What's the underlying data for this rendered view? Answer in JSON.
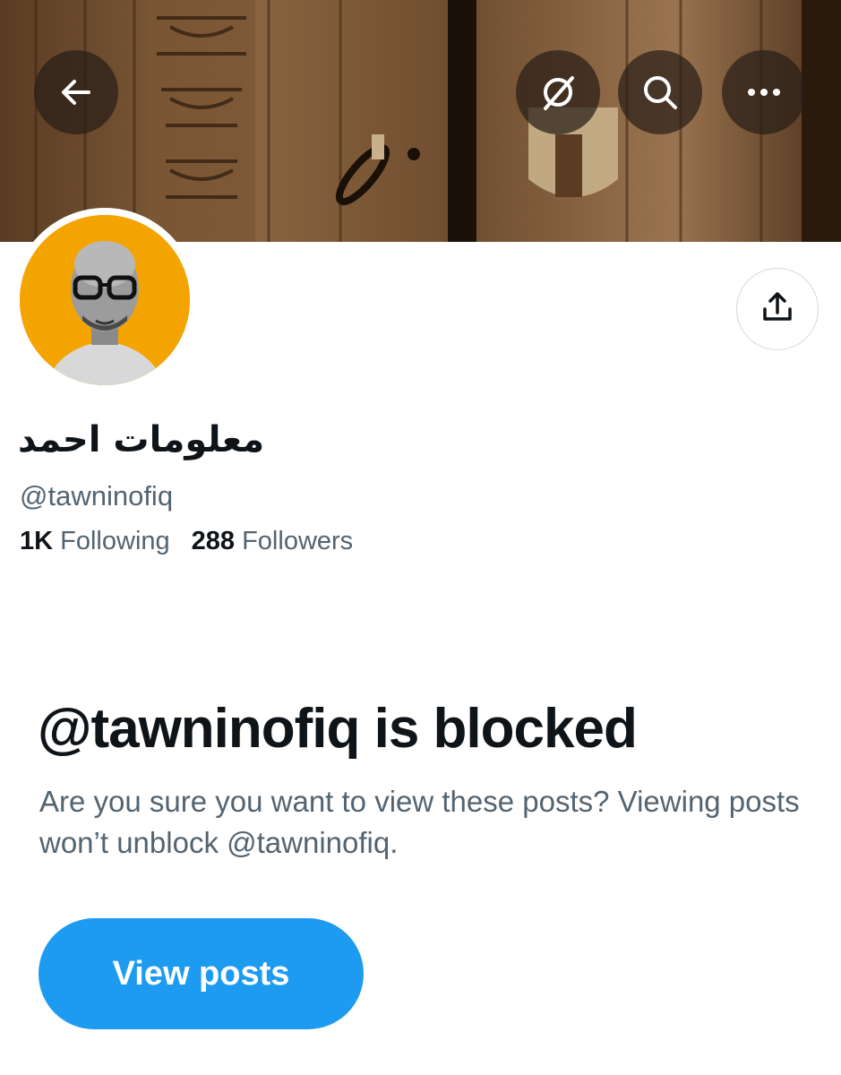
{
  "profile": {
    "display_name": "معلومات احمد",
    "handle": "@tawninofiq",
    "following_count": "1K",
    "following_label": "Following",
    "followers_count": "288",
    "followers_label": "Followers"
  },
  "blocked": {
    "title": "@tawninofiq is blocked",
    "description": "Are you sure you want to view these posts? Viewing posts won’t unblock @tawninofiq.",
    "button_label": "View posts"
  },
  "icons": {
    "back": "arrow-left-icon",
    "grok": "grok-icon",
    "search": "search-icon",
    "more": "more-icon",
    "share": "share-icon"
  },
  "colors": {
    "accent": "#1d9bf0",
    "secondary_text": "#536471",
    "primary_text": "#0f1419",
    "avatar_background": "#f4a400"
  }
}
